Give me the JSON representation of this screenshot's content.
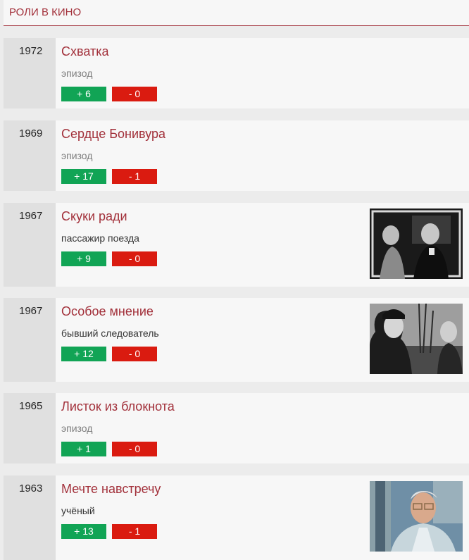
{
  "section": {
    "title": "РОЛИ В КИНО"
  },
  "roles": [
    {
      "year": "1972",
      "title": "Схватка",
      "role": "эпизод",
      "plus": "+ 6",
      "minus": "- 0"
    },
    {
      "year": "1969",
      "title": "Сердце Бонивура",
      "role": "эпизод",
      "plus": "+ 17",
      "minus": "- 1"
    },
    {
      "year": "1967",
      "title": "Скуки ради",
      "role": "пассажир поезда",
      "plus": "+ 9",
      "minus": "- 0"
    },
    {
      "year": "1967",
      "title": "Особое мнение",
      "role": "бывший следователь",
      "plus": "+ 12",
      "minus": "- 0"
    },
    {
      "year": "1965",
      "title": "Листок из блокнота",
      "role": "эпизод",
      "plus": "+ 1",
      "minus": "- 0"
    },
    {
      "year": "1963",
      "title": "Мечте навстречу",
      "role": "учёный",
      "plus": "+ 13",
      "minus": "- 1"
    }
  ],
  "colors": {
    "accent": "#a2303a",
    "vote_plus": "#11a455",
    "vote_minus": "#da1b10",
    "year_bg": "#e0e0e0",
    "row_bg": "#f7f7f7"
  }
}
